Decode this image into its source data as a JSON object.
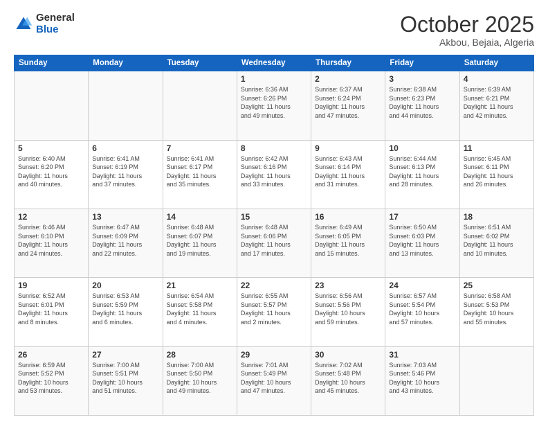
{
  "logo": {
    "general": "General",
    "blue": "Blue"
  },
  "title": "October 2025",
  "location": "Akbou, Bejaia, Algeria",
  "weekdays": [
    "Sunday",
    "Monday",
    "Tuesday",
    "Wednesday",
    "Thursday",
    "Friday",
    "Saturday"
  ],
  "weeks": [
    [
      {
        "day": "",
        "info": ""
      },
      {
        "day": "",
        "info": ""
      },
      {
        "day": "",
        "info": ""
      },
      {
        "day": "1",
        "info": "Sunrise: 6:36 AM\nSunset: 6:26 PM\nDaylight: 11 hours\nand 49 minutes."
      },
      {
        "day": "2",
        "info": "Sunrise: 6:37 AM\nSunset: 6:24 PM\nDaylight: 11 hours\nand 47 minutes."
      },
      {
        "day": "3",
        "info": "Sunrise: 6:38 AM\nSunset: 6:23 PM\nDaylight: 11 hours\nand 44 minutes."
      },
      {
        "day": "4",
        "info": "Sunrise: 6:39 AM\nSunset: 6:21 PM\nDaylight: 11 hours\nand 42 minutes."
      }
    ],
    [
      {
        "day": "5",
        "info": "Sunrise: 6:40 AM\nSunset: 6:20 PM\nDaylight: 11 hours\nand 40 minutes."
      },
      {
        "day": "6",
        "info": "Sunrise: 6:41 AM\nSunset: 6:19 PM\nDaylight: 11 hours\nand 37 minutes."
      },
      {
        "day": "7",
        "info": "Sunrise: 6:41 AM\nSunset: 6:17 PM\nDaylight: 11 hours\nand 35 minutes."
      },
      {
        "day": "8",
        "info": "Sunrise: 6:42 AM\nSunset: 6:16 PM\nDaylight: 11 hours\nand 33 minutes."
      },
      {
        "day": "9",
        "info": "Sunrise: 6:43 AM\nSunset: 6:14 PM\nDaylight: 11 hours\nand 31 minutes."
      },
      {
        "day": "10",
        "info": "Sunrise: 6:44 AM\nSunset: 6:13 PM\nDaylight: 11 hours\nand 28 minutes."
      },
      {
        "day": "11",
        "info": "Sunrise: 6:45 AM\nSunset: 6:11 PM\nDaylight: 11 hours\nand 26 minutes."
      }
    ],
    [
      {
        "day": "12",
        "info": "Sunrise: 6:46 AM\nSunset: 6:10 PM\nDaylight: 11 hours\nand 24 minutes."
      },
      {
        "day": "13",
        "info": "Sunrise: 6:47 AM\nSunset: 6:09 PM\nDaylight: 11 hours\nand 22 minutes."
      },
      {
        "day": "14",
        "info": "Sunrise: 6:48 AM\nSunset: 6:07 PM\nDaylight: 11 hours\nand 19 minutes."
      },
      {
        "day": "15",
        "info": "Sunrise: 6:48 AM\nSunset: 6:06 PM\nDaylight: 11 hours\nand 17 minutes."
      },
      {
        "day": "16",
        "info": "Sunrise: 6:49 AM\nSunset: 6:05 PM\nDaylight: 11 hours\nand 15 minutes."
      },
      {
        "day": "17",
        "info": "Sunrise: 6:50 AM\nSunset: 6:03 PM\nDaylight: 11 hours\nand 13 minutes."
      },
      {
        "day": "18",
        "info": "Sunrise: 6:51 AM\nSunset: 6:02 PM\nDaylight: 11 hours\nand 10 minutes."
      }
    ],
    [
      {
        "day": "19",
        "info": "Sunrise: 6:52 AM\nSunset: 6:01 PM\nDaylight: 11 hours\nand 8 minutes."
      },
      {
        "day": "20",
        "info": "Sunrise: 6:53 AM\nSunset: 5:59 PM\nDaylight: 11 hours\nand 6 minutes."
      },
      {
        "day": "21",
        "info": "Sunrise: 6:54 AM\nSunset: 5:58 PM\nDaylight: 11 hours\nand 4 minutes."
      },
      {
        "day": "22",
        "info": "Sunrise: 6:55 AM\nSunset: 5:57 PM\nDaylight: 11 hours\nand 2 minutes."
      },
      {
        "day": "23",
        "info": "Sunrise: 6:56 AM\nSunset: 5:56 PM\nDaylight: 10 hours\nand 59 minutes."
      },
      {
        "day": "24",
        "info": "Sunrise: 6:57 AM\nSunset: 5:54 PM\nDaylight: 10 hours\nand 57 minutes."
      },
      {
        "day": "25",
        "info": "Sunrise: 6:58 AM\nSunset: 5:53 PM\nDaylight: 10 hours\nand 55 minutes."
      }
    ],
    [
      {
        "day": "26",
        "info": "Sunrise: 6:59 AM\nSunset: 5:52 PM\nDaylight: 10 hours\nand 53 minutes."
      },
      {
        "day": "27",
        "info": "Sunrise: 7:00 AM\nSunset: 5:51 PM\nDaylight: 10 hours\nand 51 minutes."
      },
      {
        "day": "28",
        "info": "Sunrise: 7:00 AM\nSunset: 5:50 PM\nDaylight: 10 hours\nand 49 minutes."
      },
      {
        "day": "29",
        "info": "Sunrise: 7:01 AM\nSunset: 5:49 PM\nDaylight: 10 hours\nand 47 minutes."
      },
      {
        "day": "30",
        "info": "Sunrise: 7:02 AM\nSunset: 5:48 PM\nDaylight: 10 hours\nand 45 minutes."
      },
      {
        "day": "31",
        "info": "Sunrise: 7:03 AM\nSunset: 5:46 PM\nDaylight: 10 hours\nand 43 minutes."
      },
      {
        "day": "",
        "info": ""
      }
    ]
  ]
}
